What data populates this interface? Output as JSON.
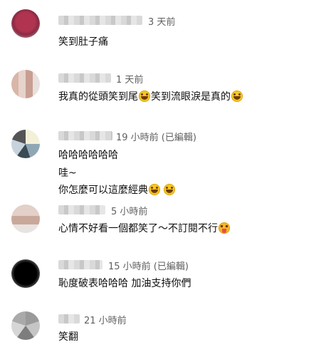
{
  "comments": [
    {
      "time": "3 天前",
      "lines": [
        {
          "text": "笑到肚子痛"
        }
      ]
    },
    {
      "time": "1 天前",
      "lines": [
        {
          "text": "我真的從頭笑到尾",
          "text2": "笑到流眼淚是真的"
        }
      ]
    },
    {
      "time": "19 小時前 (已編輯)",
      "lines": [
        {
          "text": "哈哈哈哈哈哈"
        },
        {
          "text": "哇~"
        },
        {
          "text": "你怎麼可以這麼經典"
        }
      ]
    },
    {
      "time": "5 小時前",
      "lines": [
        {
          "text": "心情不好看一個都笑了～不訂閱不行"
        }
      ]
    },
    {
      "time": "15 小時前 (已編輯)",
      "lines": [
        {
          "text": "恥度破表哈哈哈 加油支持你們"
        }
      ]
    },
    {
      "time": "21 小時前",
      "lines": [
        {
          "text": "笑翻"
        }
      ]
    }
  ],
  "emoji": {
    "grin": "grinning-face-with-sweat",
    "tongue": "squinting-face-with-tongue"
  }
}
